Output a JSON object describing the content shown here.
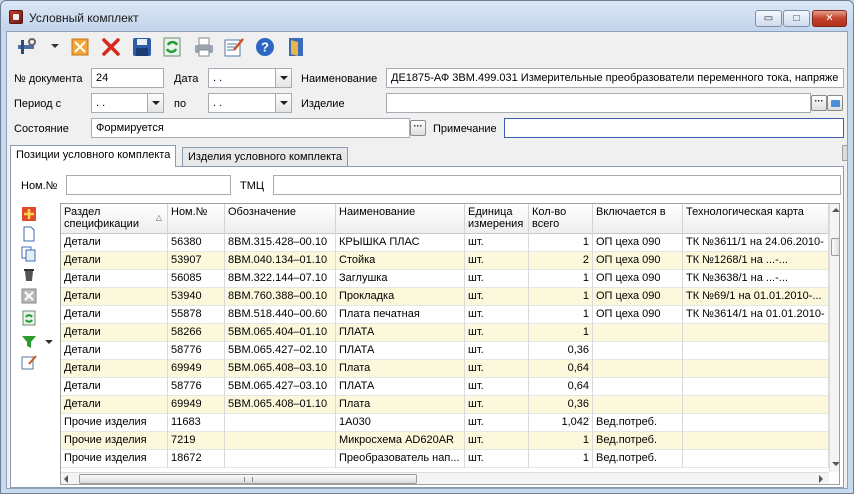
{
  "window": {
    "title": "Условный комплект",
    "controls": {
      "minimize": "▭",
      "maximize": "□",
      "close": "✕"
    }
  },
  "toolbar": {
    "buttons": [
      {
        "icon": "tools-icon"
      },
      {
        "icon": "edit-icon"
      },
      {
        "icon": "delete-icon"
      },
      {
        "icon": "save-icon"
      },
      {
        "icon": "refresh-icon"
      },
      {
        "icon": "print-icon"
      },
      {
        "icon": "notes-icon"
      },
      {
        "icon": "help-icon"
      },
      {
        "icon": "exit-icon"
      }
    ]
  },
  "form": {
    "doc_number_label": "№ документа",
    "doc_number_value": "24",
    "date_label": "Дата",
    "date_value": " . .",
    "name_label": "Наименование",
    "name_value": "ДЕ1875-АФ  3ВМ.499.031 Измерительные преобразователи переменного тока, напряже",
    "period_label": "Период с",
    "period_from_value": " . .",
    "period_to_label": "по",
    "period_to_value": " . .",
    "product_label": "Изделие",
    "product_value": "",
    "state_label": "Состояние",
    "state_value": "Формируется",
    "note_label": "Примечание",
    "note_value": ""
  },
  "tabs": [
    {
      "label": "Позиции условного комплекта",
      "active": true
    },
    {
      "label": "Изделия условного комплекта",
      "active": false
    }
  ],
  "filters": {
    "nom_label": "Ном.№",
    "nom_value": "",
    "tmc_label": "ТМЦ",
    "tmc_value": ""
  },
  "grid": {
    "columns": [
      "Раздел спецификации",
      "Ном.№",
      "Обозначение",
      "Наименование",
      "Единица измерения",
      "Кол-во всего",
      "Включается в",
      "Технологическая карта"
    ],
    "rows": [
      [
        "Детали",
        "56380",
        "8ВМ.315.428–00.10",
        "КРЫШКА ПЛАС",
        "шт.",
        "1",
        "ОП цеха 090",
        "ТК №3611/1 на  24.06.2010-"
      ],
      [
        "Детали",
        "53907",
        "8ВМ.040.134–01.10",
        "Стойка",
        "шт.",
        "2",
        "ОП цеха 090",
        "ТК №1268/1 на  ...-..."
      ],
      [
        "Детали",
        "56085",
        "8ВМ.322.144–07.10",
        "Заглушка",
        "шт.",
        "1",
        "ОП цеха 090",
        "ТК №3638/1 на  ...-..."
      ],
      [
        "Детали",
        "53940",
        "8ВМ.760.388–00.10",
        "Прокладка",
        "шт.",
        "1",
        "ОП цеха 090",
        "ТК №69/1 на  01.01.2010-..."
      ],
      [
        "Детали",
        "55878",
        "8ВМ.518.440–00.60",
        "Плата печатная",
        "шт.",
        "1",
        "ОП цеха 090",
        "ТК №3614/1 на  01.01.2010-"
      ],
      [
        "Детали",
        "58266",
        "5ВМ.065.404–01.10",
        "ПЛАТА",
        "шт.",
        "1",
        "",
        ""
      ],
      [
        "Детали",
        "58776",
        "5ВМ.065.427–02.10",
        "ПЛАТА",
        "шт.",
        "0,36",
        "",
        ""
      ],
      [
        "Детали",
        "69949",
        "5ВМ.065.408–03.10",
        "Плата",
        "шт.",
        "0,64",
        "",
        ""
      ],
      [
        "Детали",
        "58776",
        "5ВМ.065.427–03.10",
        "ПЛАТА",
        "шт.",
        "0,64",
        "",
        ""
      ],
      [
        "Детали",
        "69949",
        "5ВМ.065.408–01.10",
        "Плата",
        "шт.",
        "0,36",
        "",
        ""
      ],
      [
        "Прочие изделия",
        "11683",
        "",
        "1А030",
        "шт.",
        "1,042",
        "Вед.потреб.",
        ""
      ],
      [
        "Прочие изделия",
        "7219",
        "",
        "Микросхема AD620AR",
        "шт.",
        "1",
        "Вед.потреб.",
        ""
      ],
      [
        "Прочие изделия",
        "18672",
        "",
        "Преобразователь нап...",
        "шт.",
        "1",
        "Вед.потреб.",
        ""
      ]
    ]
  },
  "side_toolbar": [
    {
      "icon": "add-row-icon"
    },
    {
      "icon": "new-document-icon"
    },
    {
      "icon": "copy-icon"
    },
    {
      "icon": "trash-icon"
    },
    {
      "icon": "cancel-icon"
    },
    {
      "icon": "refresh-icon"
    },
    {
      "icon": "filter-icon"
    },
    {
      "icon": "edit-icon"
    }
  ],
  "hscroll_grip": "III"
}
